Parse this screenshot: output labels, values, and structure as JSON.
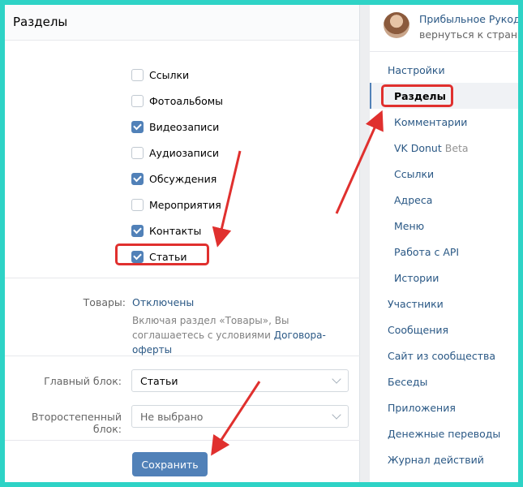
{
  "left_panel": {
    "title": "Разделы",
    "checkboxes": [
      {
        "label": "Ссылки",
        "checked": false
      },
      {
        "label": "Фотоальбомы",
        "checked": false
      },
      {
        "label": "Видеозаписи",
        "checked": true
      },
      {
        "label": "Аудиозаписи",
        "checked": false
      },
      {
        "label": "Обсуждения",
        "checked": true
      },
      {
        "label": "Мероприятия",
        "checked": false
      },
      {
        "label": "Контакты",
        "checked": true
      },
      {
        "label": "Статьи",
        "checked": true
      }
    ],
    "goods": {
      "label": "Товары:",
      "value": "Отключены",
      "note_prefix": "Включая раздел «Товары», Вы соглашаетесь с условиями",
      "note_link": "Договора-оферты"
    },
    "main_block": {
      "label": "Главный блок:",
      "value": "Статьи"
    },
    "secondary_block": {
      "label": "Второстепенный блок:",
      "value": "Не выбрано"
    },
    "save_label": "Сохранить"
  },
  "right_panel": {
    "profile": {
      "name": "Прибыльное Рукоделие",
      "subtitle": "вернуться к странице"
    },
    "menu": [
      {
        "label": "Настройки",
        "sub": false,
        "active": false
      },
      {
        "label": "Разделы",
        "sub": true,
        "active": true
      },
      {
        "label": "Комментарии",
        "sub": true,
        "active": false
      },
      {
        "label": "VK Donut",
        "badge": "Beta",
        "sub": true,
        "active": false
      },
      {
        "label": "Ссылки",
        "sub": true,
        "active": false
      },
      {
        "label": "Адреса",
        "sub": true,
        "active": false
      },
      {
        "label": "Меню",
        "sub": true,
        "active": false
      },
      {
        "label": "Работа с API",
        "sub": true,
        "active": false
      },
      {
        "label": "Истории",
        "sub": true,
        "active": false
      },
      {
        "label": "Участники",
        "sub": false,
        "active": false
      },
      {
        "label": "Сообщения",
        "sub": false,
        "active": false
      },
      {
        "label": "Сайт из сообщества",
        "sub": false,
        "active": false
      },
      {
        "label": "Беседы",
        "sub": false,
        "active": false
      },
      {
        "label": "Приложения",
        "sub": false,
        "active": false
      },
      {
        "label": "Денежные переводы",
        "sub": false,
        "active": false
      },
      {
        "label": "Журнал действий",
        "sub": false,
        "active": false
      }
    ]
  },
  "colors": {
    "accent": "#5181b8",
    "link": "#2a5885",
    "annotation_red": "#e0302e",
    "frame": "#2ed3c6"
  }
}
